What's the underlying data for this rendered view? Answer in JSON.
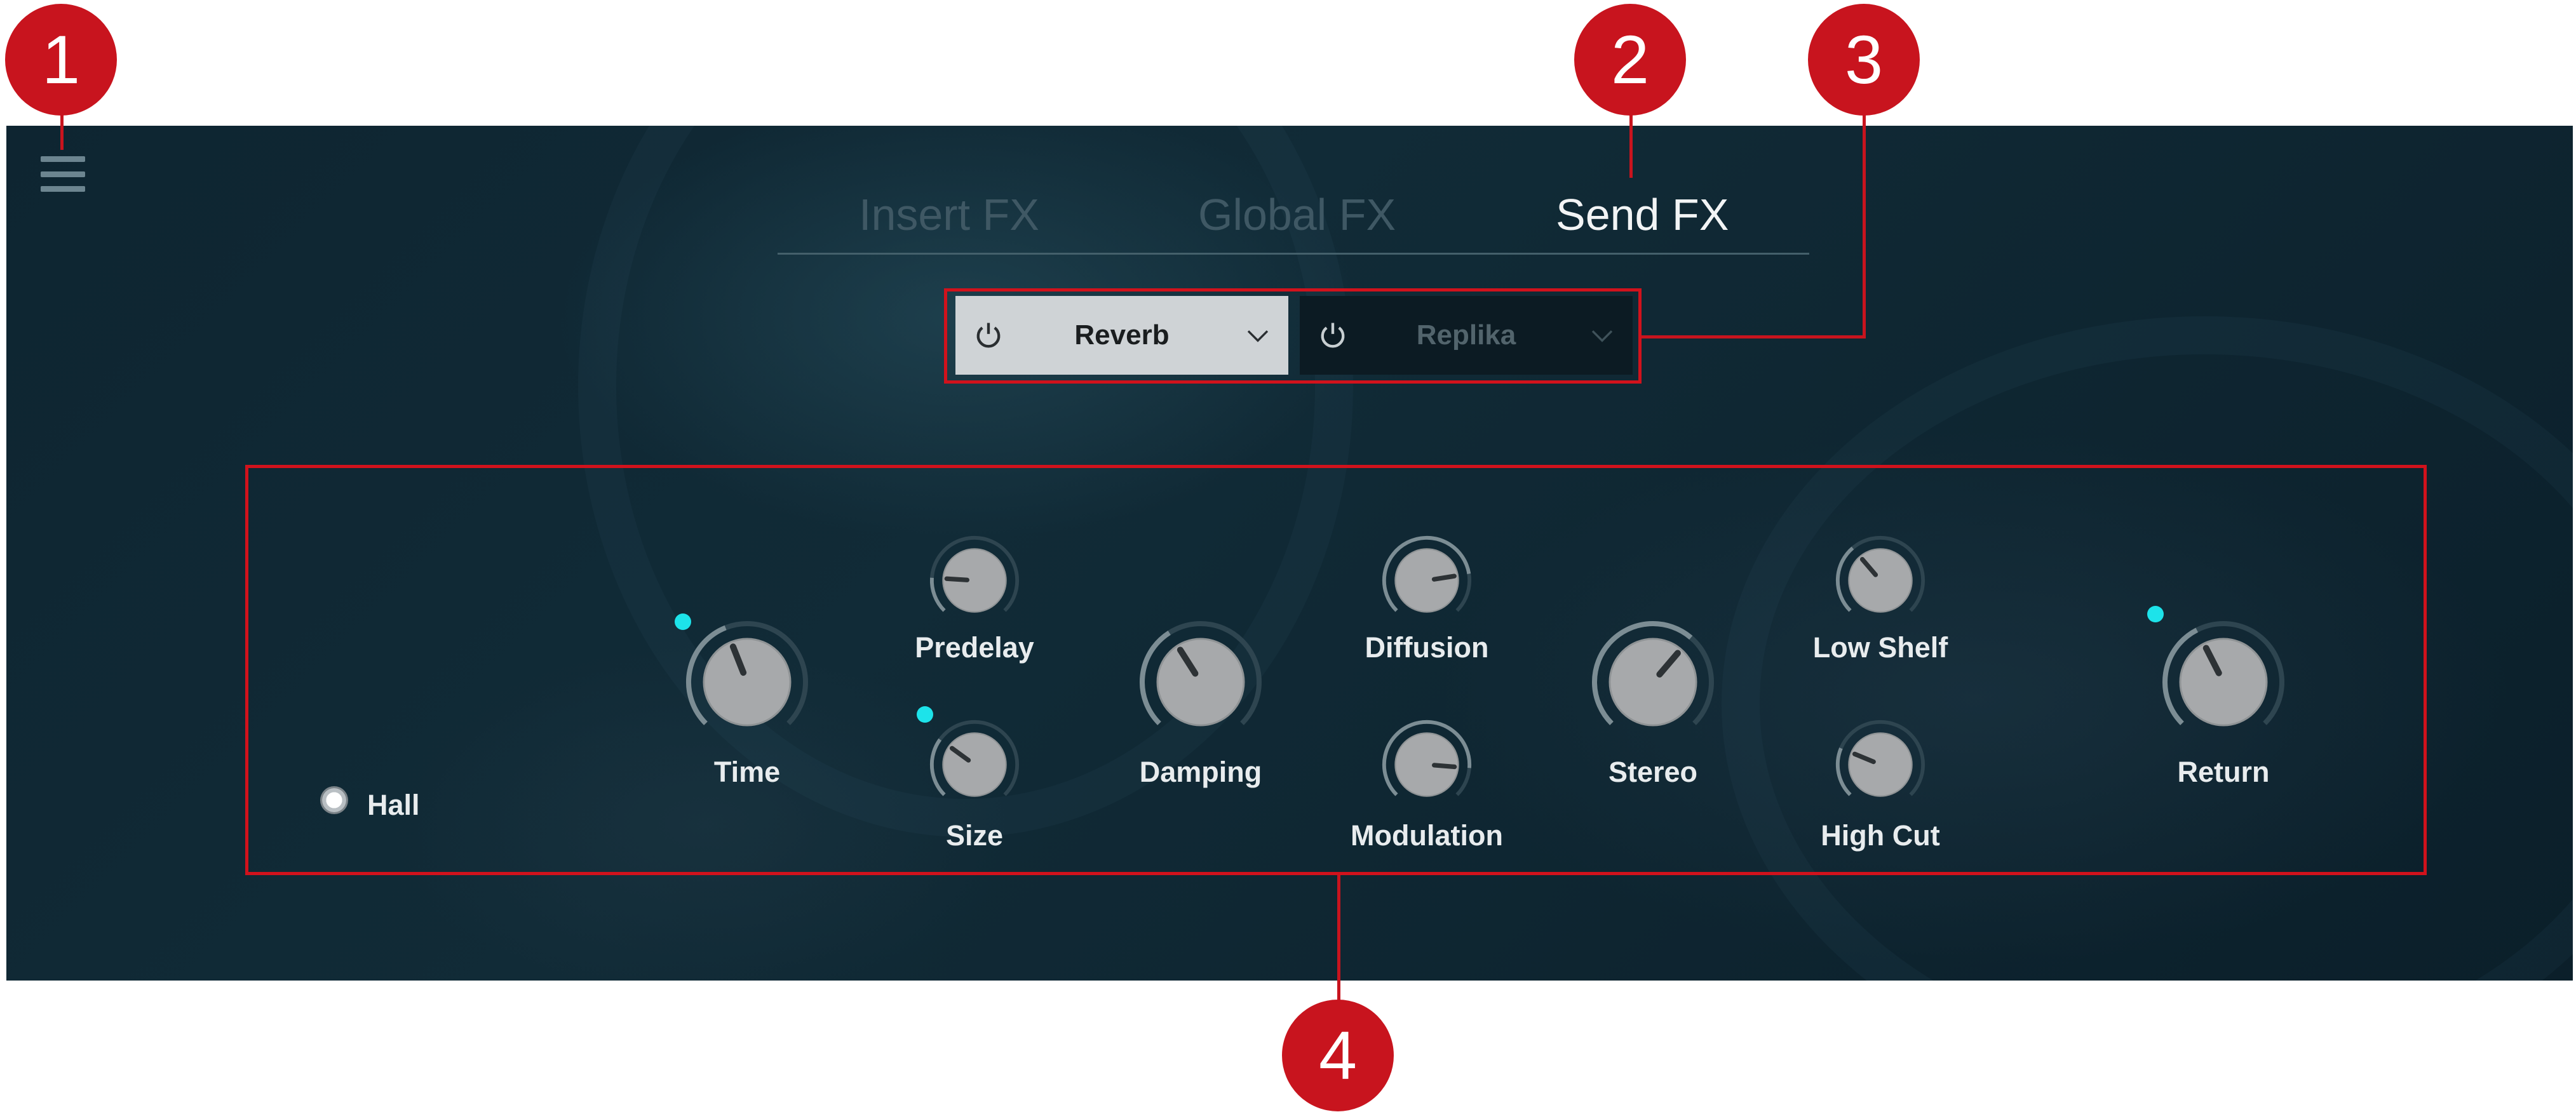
{
  "tabs": [
    {
      "label": "Insert FX",
      "active": false
    },
    {
      "label": "Global FX",
      "active": false
    },
    {
      "label": "Send FX",
      "active": true
    }
  ],
  "slots": [
    {
      "label": "Reverb",
      "active": true
    },
    {
      "label": "Replika",
      "active": false
    }
  ],
  "reverb": {
    "mode_label": "Hall",
    "knobs": {
      "time": {
        "label": "Time",
        "value": 0.42
      },
      "predelay": {
        "label": "Predelay",
        "value": 0.18
      },
      "size": {
        "label": "Size",
        "value": 0.3
      },
      "damping": {
        "label": "Damping",
        "value": 0.38
      },
      "diffusion": {
        "label": "Diffusion",
        "value": 0.8
      },
      "modulation": {
        "label": "Modulation",
        "value": 0.85
      },
      "stereo": {
        "label": "Stereo",
        "value": 0.65
      },
      "low_shelf": {
        "label": "Low Shelf",
        "value": 0.35
      },
      "high_cut": {
        "label": "High Cut",
        "value": 0.25
      },
      "return": {
        "label": "Return",
        "value": 0.4
      }
    }
  },
  "callouts": [
    "1",
    "2",
    "3",
    "4"
  ],
  "colors": {
    "callout": "#c8141e",
    "modulation_dot": "#1de3ea",
    "active_tab": "#f2f4f5",
    "inactive_tab": "#3f5864"
  }
}
